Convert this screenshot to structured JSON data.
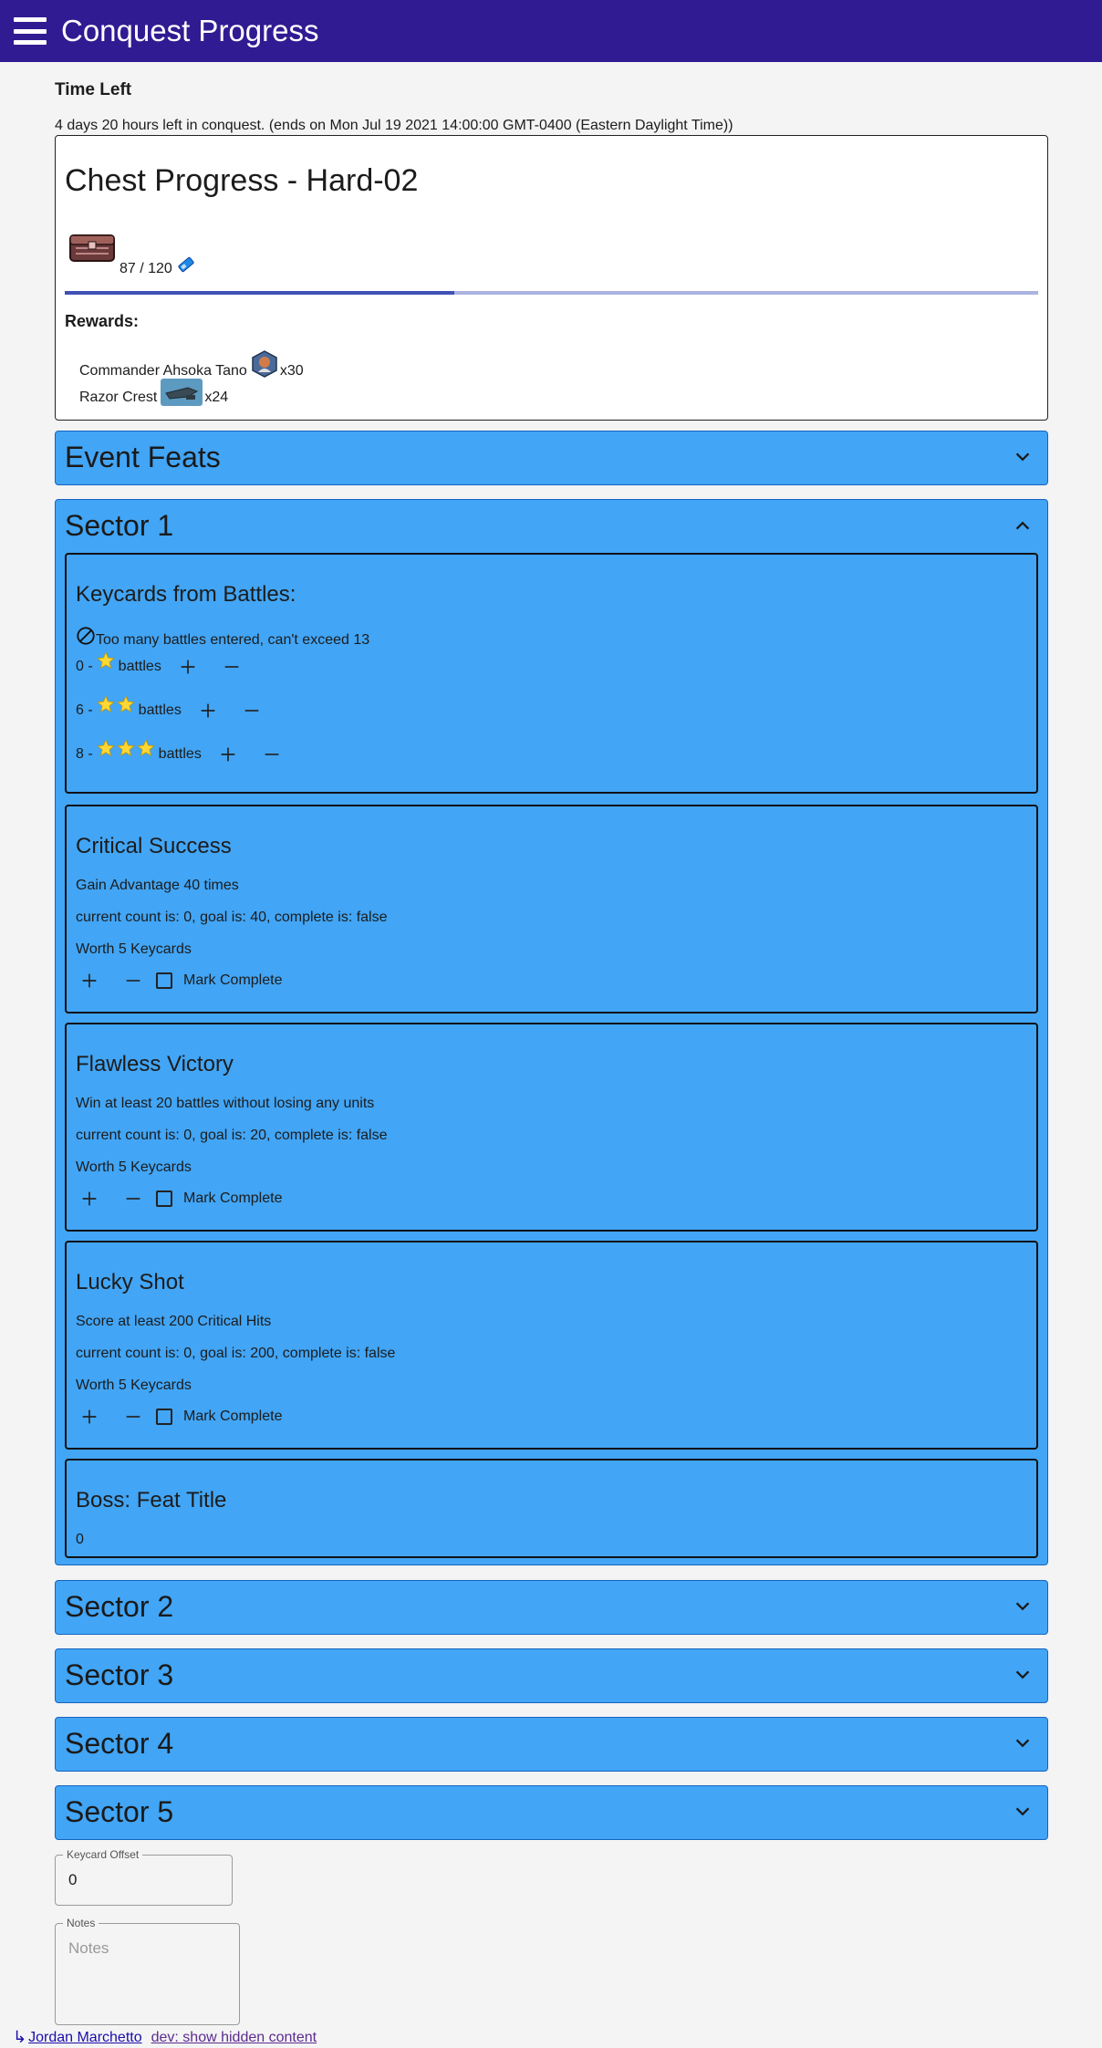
{
  "appbar": {
    "title": "Conquest Progress",
    "menu_icon": "hamburger-icon",
    "color": "#311b92"
  },
  "time": {
    "label": "Time Left",
    "text": "4 days 20 hours left in conquest. (ends on Mon Jul 19 2021 14:00:00 GMT-0400 (Eastern Daylight Time))"
  },
  "chest": {
    "title": "Chest Progress - Hard-02",
    "count": "87 / 120",
    "progress": 0.4,
    "rewards_label": "Rewards:",
    "rewards": [
      {
        "name": "Commander Ahsoka Tano",
        "qty": "x30"
      },
      {
        "name": "Razor Crest",
        "qty": "x24"
      }
    ]
  },
  "panels": {
    "event_feats": "Event Feats",
    "sector1": "Sector 1",
    "sector2": "Sector 2",
    "sector3": "Sector 3",
    "sector4": "Sector 4",
    "sector5": "Sector 5"
  },
  "keycards": {
    "title": "Keycards from Battles:",
    "error": "Too many battles entered, can't exceed 13",
    "rows": [
      {
        "count": "0 -",
        "stars": 1,
        "label": "battles"
      },
      {
        "count": "6 -",
        "stars": 2,
        "label": "battles"
      },
      {
        "count": "8 -",
        "stars": 3,
        "label": "battles"
      }
    ]
  },
  "feats": [
    {
      "title": "Critical Success",
      "desc": "Gain Advantage 40 times",
      "status": "current count is: 0, goal is: 40, complete is: false",
      "worth": "Worth 5 Keycards",
      "mark": "Mark Complete"
    },
    {
      "title": "Flawless Victory",
      "desc": "Win at least 20 battles without losing any units",
      "status": "current count is: 0, goal is: 20, complete is: false",
      "worth": "Worth 5 Keycards",
      "mark": "Mark Complete"
    },
    {
      "title": "Lucky Shot",
      "desc": "Score at least 200 Critical Hits",
      "status": "current count is: 0, goal is: 200, complete is: false",
      "worth": "Worth 5 Keycards",
      "mark": "Mark Complete"
    }
  ],
  "boss": {
    "title": "Boss: Feat Title",
    "value": "0"
  },
  "offset_field": {
    "label": "Keycard Offset",
    "value": "0"
  },
  "notes_field": {
    "label": "Notes",
    "placeholder": "Notes"
  },
  "footer": {
    "arrow": "↳",
    "user": "Jordan Marchetto",
    "dev_link": "dev: show hidden content"
  },
  "colors": {
    "panel": "#42a5f5",
    "progress_fill": "#3f51b5",
    "progress_track": "#aab3df",
    "star": "#fdd835"
  }
}
